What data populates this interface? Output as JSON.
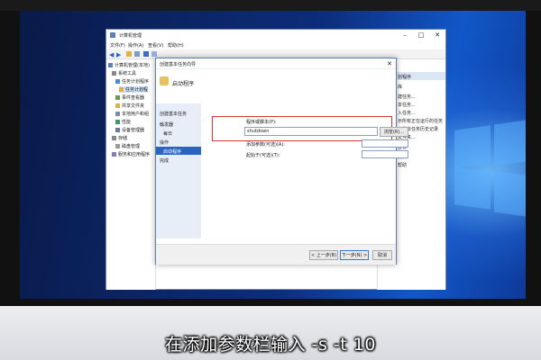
{
  "mgmt": {
    "title": "计算机管理",
    "menu": [
      "文件(F)",
      "操作(A)",
      "查看(V)",
      "帮助(H)"
    ],
    "tree": [
      "计算机管理(本地)",
      "系统工具",
      "任务计划程序",
      "任务计划程",
      "事件查看器",
      "共享文件夹",
      "本地用户和组",
      "性能",
      "设备管理器",
      "存储",
      "磁盘管理",
      "服务和应用程序"
    ],
    "actions": [
      "划程序",
      "库",
      "建任务...",
      "本任务...",
      "入任务...",
      "示所有正在运行的任务",
      "用所有任务历史记录",
      "文件夹...",
      "查看",
      "刷新",
      "帮助"
    ]
  },
  "wizard": {
    "title": "创建基本任务向导",
    "heading": "启动程序",
    "steps": [
      "创建基本任务",
      "触发器",
      "每日",
      "操作",
      "启动程序",
      "完成"
    ],
    "program_label": "程序或脚本(P):",
    "program_value": "shutdown",
    "browse_label": "浏览(R)...",
    "args_label": "添加参数(可选)(A):",
    "args_value": "",
    "start_in_label": "起始于(可选)(T):",
    "start_in_value": "",
    "back_label": "< 上一步(B)",
    "next_label": "下一步(N) >",
    "cancel_label": "取消"
  },
  "caption": "在添加参数栏输入 -s -t 10",
  "colors": {
    "highlight_border": "#d63a2a",
    "selection_blue": "#2a64c0",
    "wallpaper_blue": "#0c2d7c"
  }
}
